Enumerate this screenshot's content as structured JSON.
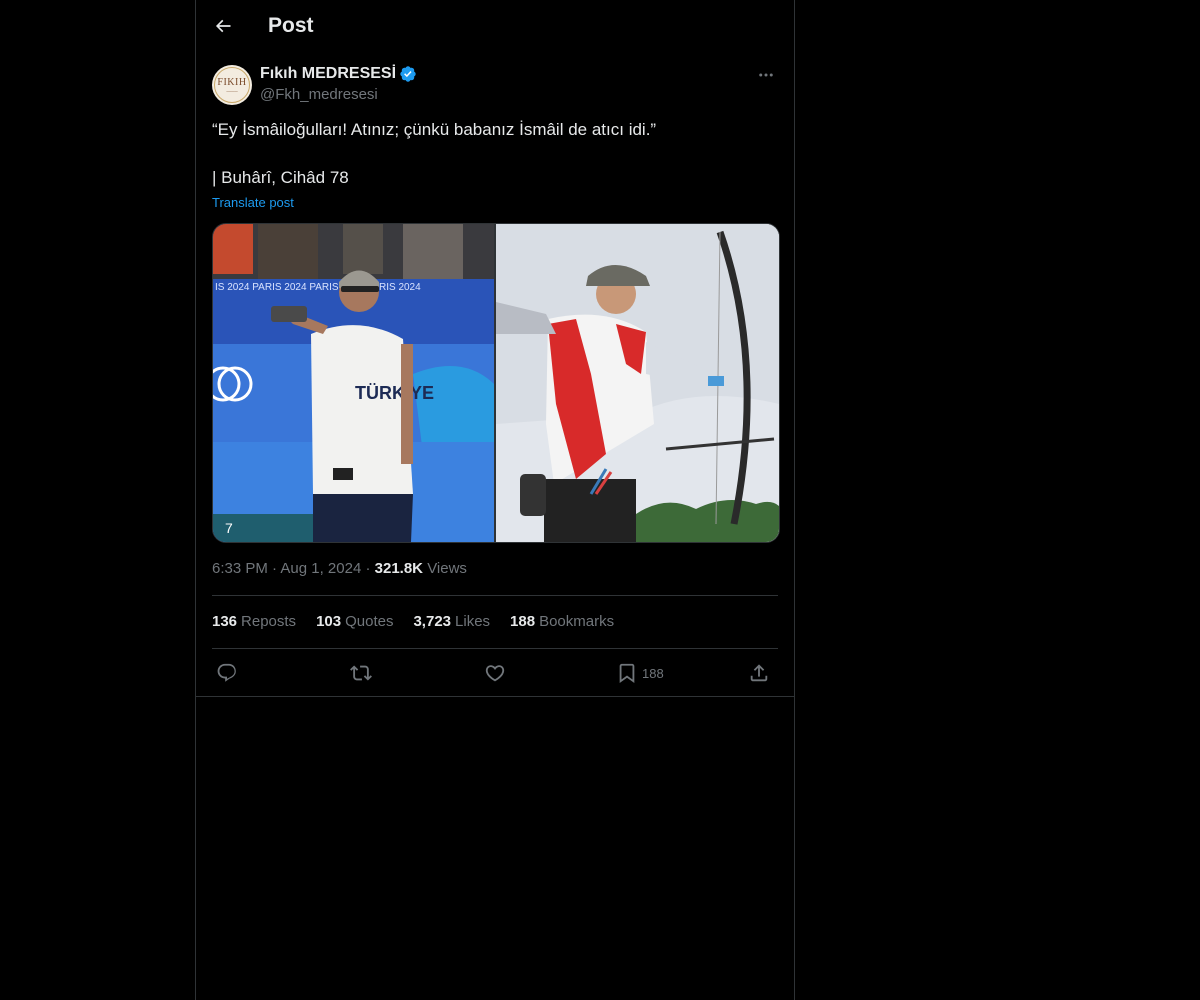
{
  "header": {
    "title": "Post"
  },
  "author": {
    "display_name": "Fıkıh MEDRESESİ",
    "handle": "@Fkh_medresesi",
    "avatar_text": "FIKIH"
  },
  "post": {
    "line1": "“Ey İsmâiloğulları! Atınız; çünkü babanız İsmâil de atıcı idi.”",
    "line2": "| Buhârî, Cihâd 78",
    "translate_label": "Translate post",
    "media_badge": "7"
  },
  "meta": {
    "time": "6:33 PM",
    "date": "Aug 1, 2024",
    "views_count": "321.8K",
    "views_label": "Views"
  },
  "stats": [
    {
      "count": "136",
      "label": "Reposts"
    },
    {
      "count": "103",
      "label": "Quotes"
    },
    {
      "count": "3,723",
      "label": "Likes"
    },
    {
      "count": "188",
      "label": "Bookmarks"
    }
  ],
  "actions": {
    "bookmark_count": "188"
  },
  "icons": [
    "back-arrow-icon",
    "verified-badge-icon",
    "more-icon",
    "reply-icon",
    "repost-icon",
    "like-icon",
    "bookmark-icon",
    "share-icon"
  ],
  "colors": {
    "accent": "#1d9bf0",
    "background": "#000000",
    "muted": "#71767b",
    "text": "#e7e9ea"
  }
}
